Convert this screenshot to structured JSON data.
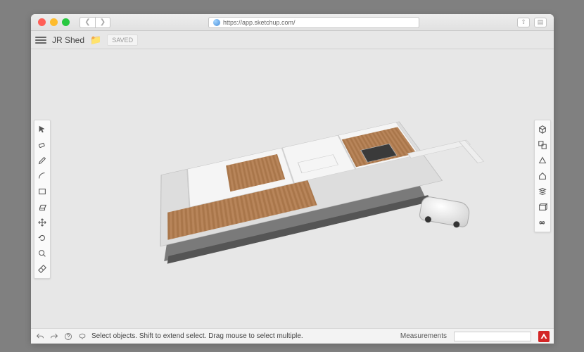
{
  "browser": {
    "url": "https://app.sketchup.com/"
  },
  "header": {
    "document_title": "JR Shed",
    "saved_label": "SAVED"
  },
  "left_tools": [
    {
      "name": "select-tool",
      "icon": "cursor"
    },
    {
      "name": "eraser-tool",
      "icon": "eraser"
    },
    {
      "name": "line-tool",
      "icon": "pencil"
    },
    {
      "name": "arc-tool",
      "icon": "arc"
    },
    {
      "name": "rectangle-tool",
      "icon": "rect"
    },
    {
      "name": "pushpull-tool",
      "icon": "pushpull"
    },
    {
      "name": "move-tool",
      "icon": "move"
    },
    {
      "name": "rotate-tool",
      "icon": "rotate"
    },
    {
      "name": "scale-tool",
      "icon": "zoom"
    },
    {
      "name": "tape-tool",
      "icon": "tape"
    }
  ],
  "right_tools": [
    {
      "name": "orbit-tool",
      "icon": "cube"
    },
    {
      "name": "pan-tool",
      "icon": "group"
    },
    {
      "name": "views-tool",
      "icon": "persp"
    },
    {
      "name": "styles-tool",
      "icon": "house"
    },
    {
      "name": "components-tool",
      "icon": "stack"
    },
    {
      "name": "layers-tool",
      "icon": "box"
    },
    {
      "name": "infinity-tool",
      "icon": "infinity"
    }
  ],
  "status": {
    "hint": "Select objects. Shift to extend select. Drag mouse to select multiple.",
    "measurements_label": "Measurements",
    "logo_text": "S"
  }
}
